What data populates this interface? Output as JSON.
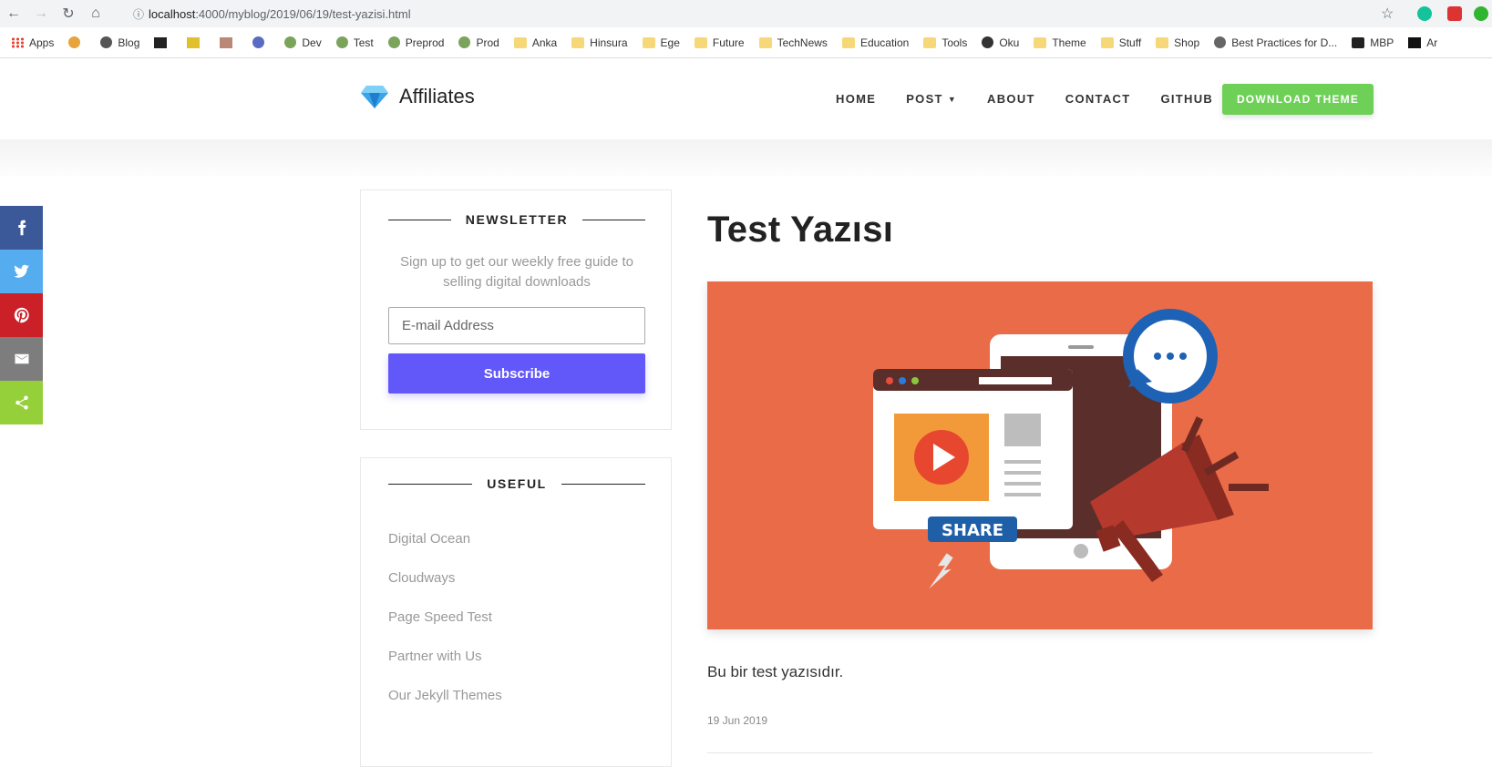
{
  "browser": {
    "url_host": "localhost",
    "url_path": ":4000/myblog/2019/06/19/test-yazisi.html",
    "bookmarks": [
      "Apps",
      "Blog",
      "Dev",
      "Test",
      "Preprod",
      "Prod",
      "Anka",
      "Hinsura",
      "Ege",
      "Future",
      "TechNews",
      "Education",
      "Tools",
      "Oku",
      "Theme",
      "Stuff",
      "Shop",
      "Best Practices for D...",
      "MBP",
      "Ar"
    ]
  },
  "header": {
    "logo": "Affiliates",
    "nav": [
      "HOME",
      "POST",
      "ABOUT",
      "CONTACT",
      "GITHUB"
    ],
    "cta": "DOWNLOAD THEME"
  },
  "newsletter": {
    "heading": "NEWSLETTER",
    "description": "Sign up to get our weekly free guide to selling digital downloads",
    "email_placeholder": "E-mail Address",
    "subscribe": "Subscribe"
  },
  "useful": {
    "heading": "USEFUL",
    "links": [
      "Digital Ocean",
      "Cloudways",
      "Page Speed Test",
      "Partner with Us",
      "Our Jekyll Themes"
    ]
  },
  "post": {
    "title": "Test Yazısı",
    "image_text": "SHARE",
    "body": "Bu bir test yazısıdır.",
    "date": "19 Jun 2019"
  },
  "share_bar": [
    {
      "icon": "facebook-icon",
      "color": "#3b5998"
    },
    {
      "icon": "twitter-icon",
      "color": "#55acee"
    },
    {
      "icon": "pinterest-icon",
      "color": "#cb2027"
    },
    {
      "icon": "email-icon",
      "color": "#7d7d7d"
    },
    {
      "icon": "share-icon",
      "color": "#95d03a"
    }
  ],
  "colors": {
    "cta": "#6ed057",
    "subscribe": "#6257f9",
    "hero_bg": "#ea6b48"
  }
}
